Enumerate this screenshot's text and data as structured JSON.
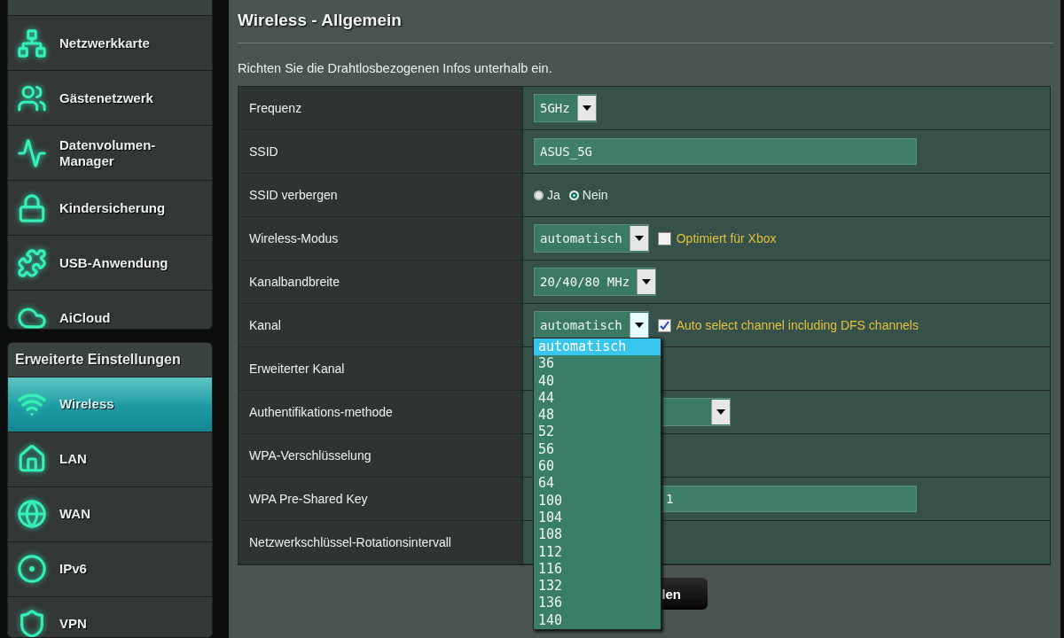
{
  "sidebar": {
    "groups": [
      {
        "items": [
          {
            "label": "Netzwerkkarte",
            "selected": false
          },
          {
            "label": "Gästenetzwerk",
            "selected": false
          },
          {
            "label": "Datenvolumen-Manager",
            "selected": false
          },
          {
            "label": "Kindersicherung",
            "selected": false
          },
          {
            "label": "USB-Anwendung",
            "selected": false
          },
          {
            "label": "AiCloud",
            "selected": false
          }
        ]
      },
      {
        "title": "Erweiterte Einstellungen",
        "items": [
          {
            "label": "Wireless",
            "selected": true
          },
          {
            "label": "LAN",
            "selected": false
          },
          {
            "label": "WAN",
            "selected": false
          },
          {
            "label": "IPv6",
            "selected": false
          },
          {
            "label": "VPN",
            "selected": false
          }
        ]
      }
    ]
  },
  "page": {
    "title": "Wireless - Allgemein",
    "description": "Richten Sie die Drahtlosbezogenen Infos unterhalb ein."
  },
  "settings": [
    {
      "label": "Frequenz",
      "kind": "select",
      "value": "5GHz"
    },
    {
      "label": "SSID",
      "kind": "text",
      "value": "ASUS_5G"
    },
    {
      "label": "SSID verbergen",
      "kind": "radio",
      "options": [
        {
          "label": "Ja",
          "selected": false
        },
        {
          "label": "Nein",
          "selected": true
        }
      ]
    },
    {
      "label": "Wireless-Modus",
      "kind": "select",
      "value": "automatisch",
      "checkbox": {
        "label": "Optimiert für Xbox",
        "checked": false
      }
    },
    {
      "label": "Kanalbandbreite",
      "kind": "select",
      "value": "20/40/80 MHz"
    },
    {
      "label": "Kanal",
      "kind": "select",
      "value": "automatisch",
      "open": true,
      "checkbox": {
        "label": "Auto select channel including DFS channels",
        "checked": true
      }
    },
    {
      "label": "Erweiterter Kanal",
      "kind": "covered"
    },
    {
      "label": "Authentifikations-methode",
      "kind": "covered_select"
    },
    {
      "label": "WPA-Verschlüsselung",
      "kind": "covered"
    },
    {
      "label": "WPA Pre-Shared Key",
      "kind": "covered_text",
      "value": "1"
    },
    {
      "label": "Netzwerkschlüssel-Rotationsintervall",
      "kind": "covered"
    }
  ],
  "channel_options": [
    {
      "label": "automatisch",
      "selected": true
    },
    {
      "label": "36",
      "selected": false
    },
    {
      "label": "40",
      "selected": false
    },
    {
      "label": "44",
      "selected": false
    },
    {
      "label": "48",
      "selected": false
    },
    {
      "label": "52",
      "selected": false
    },
    {
      "label": "56",
      "selected": false
    },
    {
      "label": "60",
      "selected": false
    },
    {
      "label": "64",
      "selected": false
    },
    {
      "label": "100",
      "selected": false
    },
    {
      "label": "104",
      "selected": false
    },
    {
      "label": "108",
      "selected": false
    },
    {
      "label": "112",
      "selected": false
    },
    {
      "label": "116",
      "selected": false
    },
    {
      "label": "132",
      "selected": false
    },
    {
      "label": "136",
      "selected": false
    },
    {
      "label": "140",
      "selected": false
    }
  ],
  "apply_button": {
    "label": "len"
  }
}
